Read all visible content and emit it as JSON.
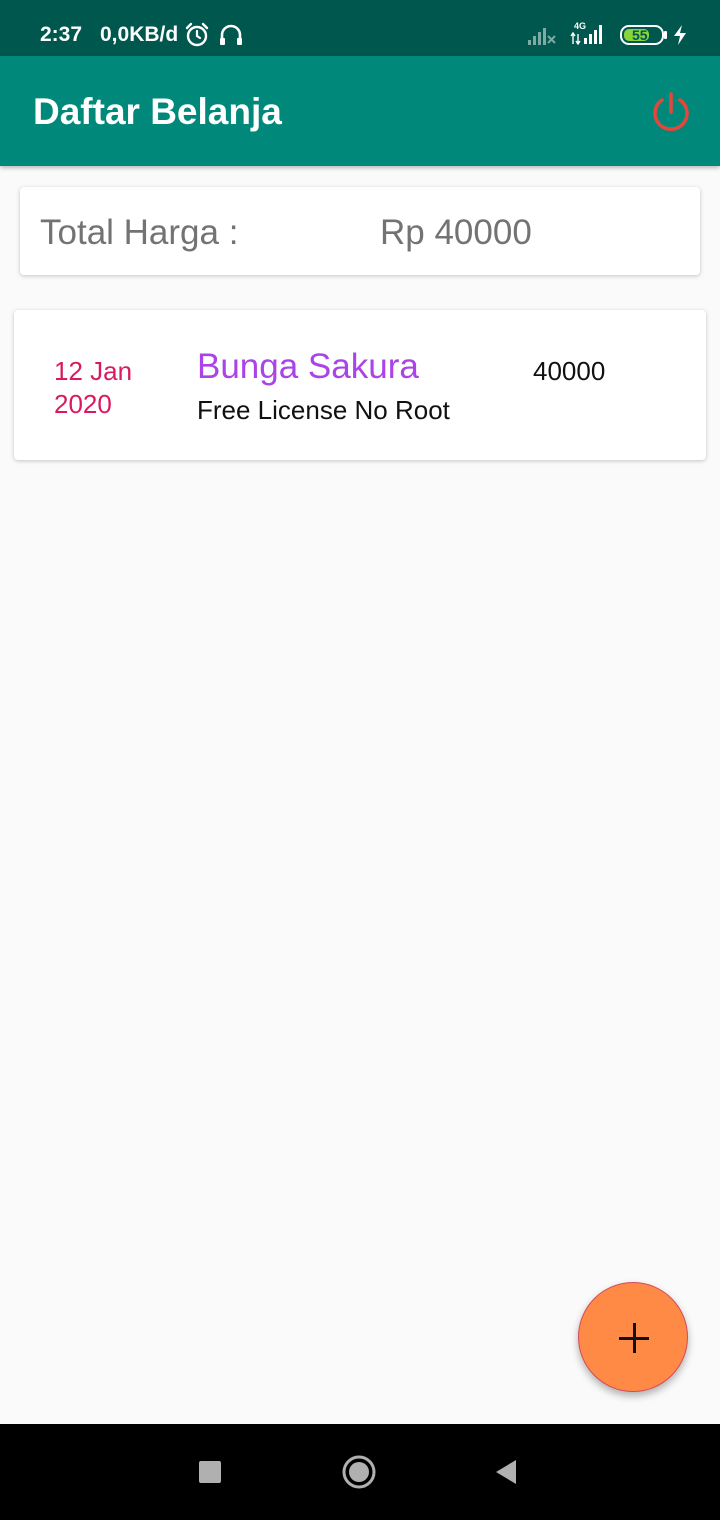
{
  "status_bar": {
    "time": "2:37",
    "network_speed": "0,0KB/d",
    "icons": [
      "alarm-icon",
      "headset-icon",
      "signal-off-icon",
      "signal-4g-icon",
      "battery-icon",
      "charging-icon"
    ],
    "network_type": "4G",
    "battery_level": "55"
  },
  "app_bar": {
    "title": "Daftar Belanja",
    "power_icon": "power-icon",
    "color": "#00897b",
    "power_color": "#e0483b"
  },
  "summary": {
    "total_label": "Total Harga :",
    "total_value": "Rp 40000"
  },
  "items": [
    {
      "date": "12 Jan 2020",
      "name": "Bunga Sakura",
      "description": "Free License No Root",
      "price": "40000",
      "date_color": "#d81b60",
      "name_color": "#aa44e6"
    }
  ],
  "fab": {
    "icon": "plus-icon",
    "color": "#ff8a45"
  },
  "nav_bar": {
    "icons": [
      "recent-apps-icon",
      "home-icon",
      "back-icon"
    ]
  }
}
